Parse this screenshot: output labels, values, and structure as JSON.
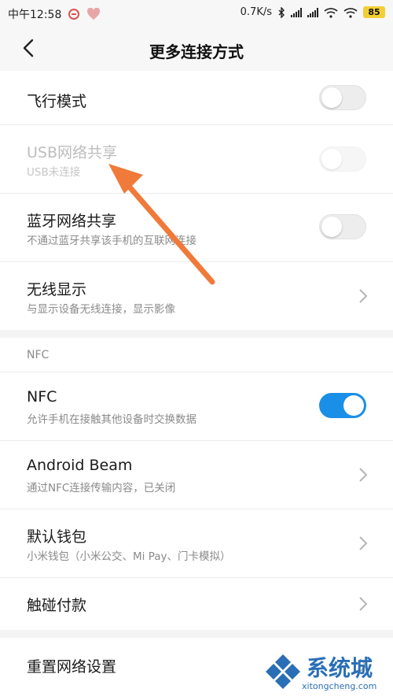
{
  "status": {
    "time": "中午12:58",
    "speed": "0.7K/s",
    "battery": "85"
  },
  "header": {
    "title": "更多连接方式"
  },
  "rows": [
    {
      "label": "飞行模式",
      "sub": ""
    },
    {
      "label": "USB网络共享",
      "sub": "USB未连接"
    },
    {
      "label": "蓝牙网络共享",
      "sub": "不通过蓝牙共享该手机的互联网连接"
    },
    {
      "label": "无线显示",
      "sub": "与显示设备无线连接，显示影像"
    }
  ],
  "nfc_section": {
    "header": "NFC",
    "rows": [
      {
        "label": "NFC",
        "sub": "允许手机在接触其他设备时交换数据"
      },
      {
        "label": "Android Beam",
        "sub": "通过NFC连接传输内容，已关闭"
      },
      {
        "label": "默认钱包",
        "sub": "小米钱包（小米公交、Mi Pay、门卡模拟）"
      },
      {
        "label": "触碰付款",
        "sub": ""
      }
    ]
  },
  "reset": {
    "label": "重置网络设置"
  },
  "toggles": {
    "airplane": false,
    "usb": false,
    "bluetooth_tether": false,
    "nfc": true
  },
  "colors": {
    "accent": "#1a8fe8",
    "arrow": "#f07a3a"
  },
  "watermark": {
    "text": "系统城",
    "url": "xitongcheng.com"
  }
}
